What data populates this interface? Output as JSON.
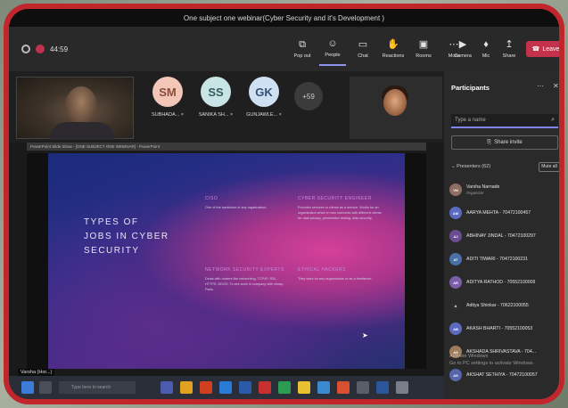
{
  "window": {
    "title": "One subject one webinar(Cyber Security and it's Development )"
  },
  "toolbar": {
    "timer": "44:59",
    "buttons": [
      {
        "label": "Pop out",
        "icon": "popout-icon"
      },
      {
        "label": "People",
        "icon": "people-icon"
      },
      {
        "label": "Chat",
        "icon": "chat-icon"
      },
      {
        "label": "Reactions",
        "icon": "reactions-icon"
      },
      {
        "label": "Rooms",
        "icon": "rooms-icon"
      },
      {
        "label": "More",
        "icon": "more-icon"
      }
    ],
    "media": [
      {
        "label": "Camera",
        "icon": "camera-icon"
      },
      {
        "label": "Mic",
        "icon": "mic-icon"
      },
      {
        "label": "Share",
        "icon": "share-icon"
      }
    ],
    "leave_label": "Leave"
  },
  "video_row": {
    "tiles": [
      {
        "initials": "SM",
        "name": "SUBHADA... ×",
        "bg": "#f2c7b8",
        "fg": "#8a4b3a"
      },
      {
        "initials": "SS",
        "name": "SANIKA SH... ×",
        "bg": "#c9e4e4",
        "fg": "#355c5c"
      },
      {
        "initials": "GK",
        "name": "GUNJAWLE... ×",
        "bg": "#cfe0f2",
        "fg": "#355073"
      }
    ],
    "more_count": "+59"
  },
  "you_label": "Varsha (Hor...)",
  "slide": {
    "ppt_title": "PowerPoint Slide Show - [ONE SUBJECT ONE WEBINAR] - PowerPoint",
    "title": "TYPES OF\nJOBS IN CYBER\nSECURITY",
    "jobs": [
      {
        "head": "CISO",
        "text": "One of the backbone of any organization."
      },
      {
        "head": "CYBER SECURITY ENGINEER",
        "text": "Provides services to clients as a service. Works for an organization which in turn connects with different clients for data privacy, penetration testing, data security."
      },
      {
        "head": "NETWORK SECURITY EXPERTS",
        "text": "Deals with routers like networking, TCP/IP, SSL, HTTPS, DDOS. To see work in company with cheap Pads."
      },
      {
        "head": "ETHICAL HACKERS",
        "text": "They work for any organization or as a freelancer."
      }
    ]
  },
  "taskbar": {
    "search_placeholder": "Type here to search"
  },
  "panel": {
    "title": "Participants",
    "search_placeholder": "Type a name",
    "share_invite": "Share invite",
    "presenters_label": "Presenters (62)",
    "mute_all": "Mute all",
    "participants": [
      {
        "name": "Varsha Narnade",
        "role": "Organizer",
        "initials": "VN",
        "color": "#8d6e63"
      },
      {
        "name": "AARYA MEHTA - 70472100457",
        "role": "",
        "initials": "AM",
        "color": "#5b6bc0"
      },
      {
        "name": "ABHINAY JINDAL - 70472100297",
        "role": "",
        "initials": "AJ",
        "color": "#6a4c93"
      },
      {
        "name": "ADITI TIWARI - 70472100231",
        "role": "",
        "initials": "AT",
        "color": "#4a70a8"
      },
      {
        "name": "ADITYA RATHOD - 70552100009",
        "role": "",
        "initials": "AR",
        "color": "#7a5ea8"
      },
      {
        "name": "Aditya Shinkar - 70622100055",
        "role": "",
        "initials": "A",
        "color": "#2c2c2c"
      },
      {
        "name": "AKASH BHARTI - 70552100053",
        "role": "",
        "initials": "AB",
        "color": "#5c6bc0"
      },
      {
        "name": "AKSHADA SHRIVASTAVA - 704...",
        "role": "",
        "initials": "AS",
        "color": "#9e7b5a"
      },
      {
        "name": "AKSHAT SETHIYA - 70472100057",
        "role": "",
        "initials": "AS",
        "color": "#5566aa"
      }
    ],
    "activate_line1": "Activate Windows",
    "activate_line2": "Go to PC settings to activate Windows."
  },
  "colors": {
    "accent": "#7f85f5",
    "leave": "#c4314b",
    "frame": "#c0262b"
  }
}
